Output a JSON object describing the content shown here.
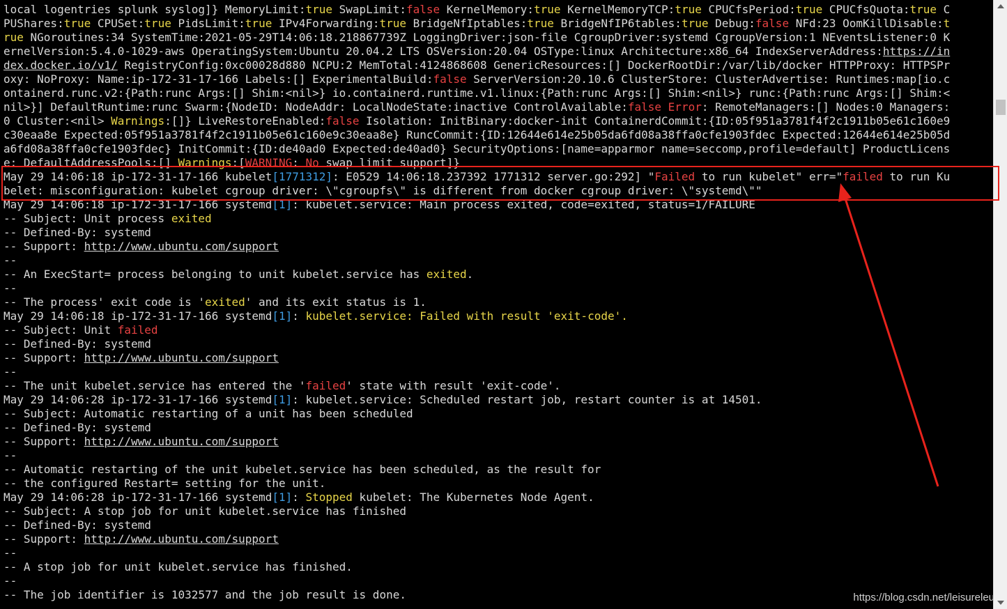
{
  "terminal": {
    "colors": {
      "text": "#d8d8d8",
      "yellow": "#e8d64a",
      "red": "#e74242",
      "cyan": "#3f9de3",
      "highlight": "#e8231c"
    },
    "lines": [
      [
        [
          "local logentries splunk syslog]} MemoryLimit:",
          ""
        ],
        [
          "true",
          "y"
        ],
        [
          " SwapLimit:",
          ""
        ],
        [
          "false",
          "r"
        ],
        [
          " KernelMemory:",
          ""
        ],
        [
          "true",
          "y"
        ],
        [
          " KernelMemoryTCP:",
          ""
        ],
        [
          "true",
          "y"
        ],
        [
          " CPUCfsPeriod:",
          ""
        ],
        [
          "true",
          "y"
        ],
        [
          " CPUCfsQuota:",
          ""
        ],
        [
          "true",
          "y"
        ],
        [
          " C",
          ""
        ]
      ],
      [
        [
          "PUShares:",
          ""
        ],
        [
          "true",
          "y"
        ],
        [
          " CPUSet:",
          ""
        ],
        [
          "true",
          "y"
        ],
        [
          " PidsLimit:",
          ""
        ],
        [
          "true",
          "y"
        ],
        [
          " IPv4Forwarding:",
          ""
        ],
        [
          "true",
          "y"
        ],
        [
          " BridgeNfIptables:",
          ""
        ],
        [
          "true",
          "y"
        ],
        [
          " BridgeNfIP6tables:",
          ""
        ],
        [
          "true",
          "y"
        ],
        [
          " Debug:",
          ""
        ],
        [
          "false",
          "r"
        ],
        [
          " NFd:23 OomKillDisable:",
          ""
        ],
        [
          "t",
          "y"
        ]
      ],
      [
        [
          "rue",
          "y"
        ],
        [
          " NGoroutines:34 SystemTime:2021-05-29T14:06:18.218867739Z LoggingDriver:json-file CgroupDriver:systemd CgroupVersion:1 NEventsListener:0 K",
          ""
        ]
      ],
      [
        [
          "ernelVersion:5.4.0-1029-aws OperatingSystem:Ubuntu 20.04.2 LTS OSVersion:20.04 OSType:linux Architecture:x86_64 IndexServerAddress:",
          ""
        ],
        [
          "https://in",
          "u"
        ]
      ],
      [
        [
          "dex.docker.io/v1/",
          "u"
        ],
        [
          " RegistryConfig:0xc00028d880 NCPU:2 MemTotal:4124868608 GenericResources:[] DockerRootDir:/var/lib/docker HTTPProxy: HTTPSPr",
          ""
        ]
      ],
      [
        [
          "oxy: NoProxy: Name:ip-172-31-17-166 Labels:[] ExperimentalBuild:",
          ""
        ],
        [
          "false",
          "r"
        ],
        [
          " ServerVersion:20.10.6 ClusterStore: ClusterAdvertise: Runtimes:map[io.c",
          ""
        ]
      ],
      [
        [
          "ontainerd.runc.v2:{Path:runc Args:[] Shim:<nil>} io.containerd.runtime.v1.linux:{Path:runc Args:[] Shim:<nil>} runc:{Path:runc Args:[] Shim:<",
          ""
        ]
      ],
      [
        [
          "nil>}] DefaultRuntime:runc Swarm:{NodeID: NodeAddr: LocalNodeState:inactive ControlAvailable:",
          ""
        ],
        [
          "false",
          "r"
        ],
        [
          " ",
          ""
        ],
        [
          "Error",
          "r"
        ],
        [
          ": RemoteManagers:[] Nodes:0 Managers:",
          ""
        ]
      ],
      [
        [
          "0 Cluster:<nil> ",
          ""
        ],
        [
          "Warnings",
          "y"
        ],
        [
          ":[]} LiveRestoreEnabled:",
          ""
        ],
        [
          "false",
          "r"
        ],
        [
          " Isolation: InitBinary:docker-init ContainerdCommit:{ID:05f951a3781f4f2c1911b05e61c160e9",
          ""
        ]
      ],
      [
        [
          "c30eaa8e Expected:05f951a3781f4f2c1911b05e61c160e9c30eaa8e} RuncCommit:{ID:12644e614e25b05da6fd08a38ffa0cfe1903fdec Expected:12644e614e25b05d",
          ""
        ]
      ],
      [
        [
          "a6fd08a38ffa0cfe1903fdec} InitCommit:{ID:de40ad0 Expected:de40ad0} SecurityOptions:[name=apparmor name=seccomp,profile=default] ProductLicens",
          ""
        ]
      ],
      [
        [
          "e: DefaultAddressPools:[] ",
          ""
        ],
        [
          "Warnings",
          "y"
        ],
        [
          ":[",
          ""
        ],
        [
          "WARNING",
          "r"
        ],
        [
          ": ",
          ""
        ],
        [
          "No",
          "r"
        ],
        [
          " swap limit support]}",
          ""
        ]
      ],
      [
        [
          "May 29 14:06:18 ip-172-31-17-166 kubelet",
          ""
        ],
        [
          "[1771312]",
          "c"
        ],
        [
          ": E0529 14:06:18.237392 1771312 server.go:292] \"",
          ""
        ],
        [
          "Failed",
          "r"
        ],
        [
          " to run kubelet\" err=\"",
          ""
        ],
        [
          "failed",
          "r"
        ],
        [
          " to run Ku",
          ""
        ]
      ],
      [
        [
          "belet: misconfiguration: kubelet cgroup driver: \\\"cgroupfs\\\" is different from docker cgroup driver: \\\"systemd\\\"\"",
          ""
        ]
      ],
      [
        [
          "May 29 14:06:18 ip-172-31-17-166 systemd",
          ""
        ],
        [
          "[1]",
          "c"
        ],
        [
          ": kubelet.service: Main process exited, code=exited, status=1/FAILURE",
          ""
        ]
      ],
      [
        [
          "-- Subject: Unit process ",
          ""
        ],
        [
          "exited",
          "y"
        ]
      ],
      [
        [
          "-- Defined-By: systemd",
          ""
        ]
      ],
      [
        [
          "-- Support: ",
          ""
        ],
        [
          "http://www.ubuntu.com/support",
          "u"
        ]
      ],
      [
        [
          "--",
          ""
        ]
      ],
      [
        [
          "-- An ExecStart= process belonging to unit kubelet.service has ",
          ""
        ],
        [
          "exited",
          "y"
        ],
        [
          ".",
          ""
        ]
      ],
      [
        [
          "--",
          ""
        ]
      ],
      [
        [
          "-- The process' exit code is '",
          ""
        ],
        [
          "exited",
          "y"
        ],
        [
          "' and its exit status is 1.",
          ""
        ]
      ],
      [
        [
          "May 29 14:06:18 ip-172-31-17-166 systemd",
          ""
        ],
        [
          "[1]",
          "c"
        ],
        [
          ": ",
          ""
        ],
        [
          "kubelet.service: Failed with result 'exit-code'.",
          "y"
        ]
      ],
      [
        [
          "-- Subject: Unit ",
          ""
        ],
        [
          "failed",
          "r"
        ]
      ],
      [
        [
          "-- Defined-By: systemd",
          ""
        ]
      ],
      [
        [
          "-- Support: ",
          ""
        ],
        [
          "http://www.ubuntu.com/support",
          "u"
        ]
      ],
      [
        [
          "--",
          ""
        ]
      ],
      [
        [
          "-- The unit kubelet.service has entered the '",
          ""
        ],
        [
          "failed",
          "r"
        ],
        [
          "' state with result 'exit-code'.",
          ""
        ]
      ],
      [
        [
          "May 29 14:06:28 ip-172-31-17-166 systemd",
          ""
        ],
        [
          "[1]",
          "c"
        ],
        [
          ": kubelet.service: Scheduled restart job, restart counter is at 14501.",
          ""
        ]
      ],
      [
        [
          "-- Subject: Automatic restarting of a unit has been scheduled",
          ""
        ]
      ],
      [
        [
          "-- Defined-By: systemd",
          ""
        ]
      ],
      [
        [
          "-- Support: ",
          ""
        ],
        [
          "http://www.ubuntu.com/support",
          "u"
        ]
      ],
      [
        [
          "--",
          ""
        ]
      ],
      [
        [
          "-- Automatic restarting of the unit kubelet.service has been scheduled, as the result for",
          ""
        ]
      ],
      [
        [
          "-- the configured Restart= setting for the unit.",
          ""
        ]
      ],
      [
        [
          "May 29 14:06:28 ip-172-31-17-166 systemd",
          ""
        ],
        [
          "[1]",
          "c"
        ],
        [
          ": ",
          ""
        ],
        [
          "Stopped",
          "y"
        ],
        [
          " kubelet: The Kubernetes Node Agent.",
          ""
        ]
      ],
      [
        [
          "-- Subject: A stop job for unit kubelet.service has finished",
          ""
        ]
      ],
      [
        [
          "-- Defined-By: systemd",
          ""
        ]
      ],
      [
        [
          "-- Support: ",
          ""
        ],
        [
          "http://www.ubuntu.com/support",
          "u"
        ]
      ],
      [
        [
          "--",
          ""
        ]
      ],
      [
        [
          "-- A stop job for unit kubelet.service has finished.",
          ""
        ]
      ],
      [
        [
          "--",
          ""
        ]
      ],
      [
        [
          "-- The job identifier is 1032577 and the job result is done.",
          ""
        ]
      ]
    ]
  },
  "watermark": "https://blog.csdn.net/leisureleu"
}
